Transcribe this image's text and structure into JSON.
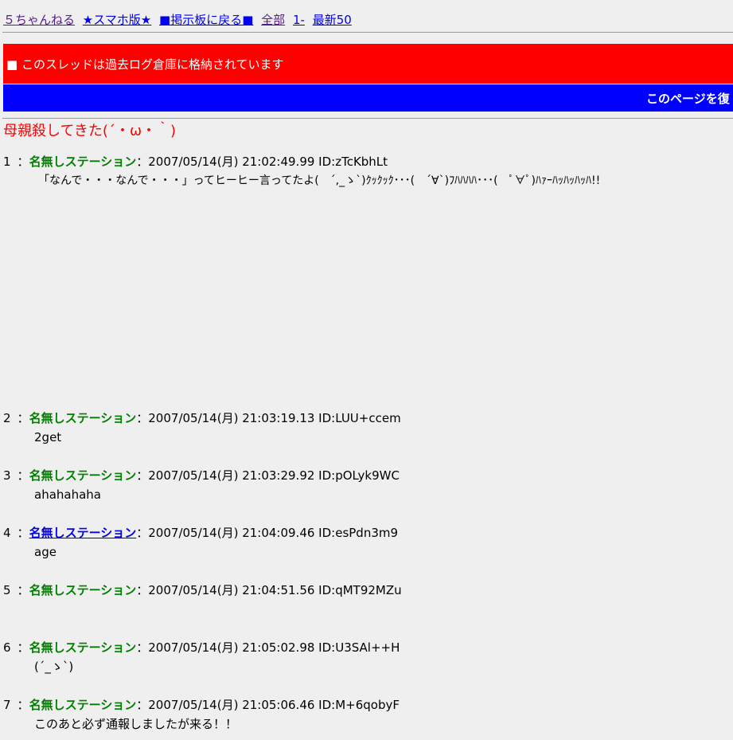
{
  "nav": {
    "links": [
      "５ちゃんねる",
      "★スマホ版★",
      "■掲示板に戻る■",
      "全部",
      "1-",
      "最新50"
    ]
  },
  "banner": {
    "archived_text": "■ このスレッドは過去ログ倉庫に格納されています",
    "blue_text": "このページを復"
  },
  "thread": {
    "title": "母親殺してきた(´・ω・｀)"
  },
  "posts": [
    {
      "num": "1",
      "sep": "：",
      "name": "名無しステーション",
      "meta": "：2007/05/14(月) 21:02:49.99 ID:zTcKbhLt",
      "body": "「なんで・・・なんで・・・」ってヒーヒー言ってたよ(　´,_ゝ`)ｸｯｸｯｸ･･･(　´∀`)ﾌﾊﾊﾊﾊ･･･(　ﾟ∀ﾟ)ﾊｧｰﾊｯﾊｯﾊｯﾊ!!"
    },
    {
      "num": "2",
      "sep": "：",
      "name": "名無しステーション",
      "meta": "：2007/05/14(月) 21:03:19.13 ID:LUU+ccem",
      "body": "2get"
    },
    {
      "num": "3",
      "sep": "：",
      "name": "名無しステーション",
      "meta": "：2007/05/14(月) 21:03:29.92 ID:pOLyk9WC",
      "body": "ahahahaha"
    },
    {
      "num": "4",
      "sep": "：",
      "name": "名無しステーション",
      "meta": "：2007/05/14(月) 21:04:09.46 ID:esPdn3m9",
      "body": "age"
    },
    {
      "num": "5",
      "sep": "：",
      "name": "名無しステーション",
      "meta": "：2007/05/14(月) 21:04:51.56 ID:qMT92MZu",
      "body": ""
    },
    {
      "num": "6",
      "sep": "：",
      "name": "名無しステーション",
      "meta": "：2007/05/14(月) 21:05:02.98 ID:U3SAl++H",
      "body": "(´_ゝ`)"
    },
    {
      "num": "7",
      "sep": "：",
      "name": "名無しステーション",
      "meta": "：2007/05/14(月) 21:05:06.46 ID:M+6qobyF",
      "body": "このあと必ず通報しましたが来る！！"
    }
  ]
}
